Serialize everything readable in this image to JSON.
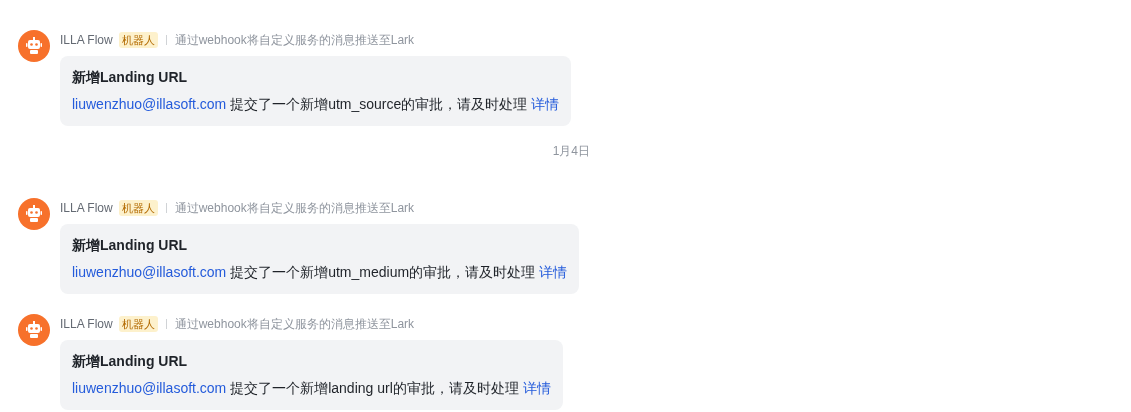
{
  "feed": [
    {
      "kind": "message",
      "sender": "ILLA Flow",
      "badge": "机器人",
      "description": "通过webhook将自定义服务的消息推送至Lark",
      "title": "新增Landing URL",
      "email": "liuwenzhuo@illasoft.com",
      "text": " 提交了一个新增utm_source的审批，请及时处理 ",
      "link": "详情"
    },
    {
      "kind": "date",
      "text": "1月4日"
    },
    {
      "kind": "message",
      "sender": "ILLA Flow",
      "badge": "机器人",
      "description": "通过webhook将自定义服务的消息推送至Lark",
      "title": "新增Landing URL",
      "email": "liuwenzhuo@illasoft.com",
      "text": " 提交了一个新增utm_medium的审批，请及时处理 ",
      "link": "详情"
    },
    {
      "kind": "message",
      "sender": "ILLA Flow",
      "badge": "机器人",
      "description": "通过webhook将自定义服务的消息推送至Lark",
      "title": "新增Landing URL",
      "email": "liuwenzhuo@illasoft.com",
      "text": " 提交了一个新增landing url的审批，请及时处理 ",
      "link": "详情"
    }
  ]
}
